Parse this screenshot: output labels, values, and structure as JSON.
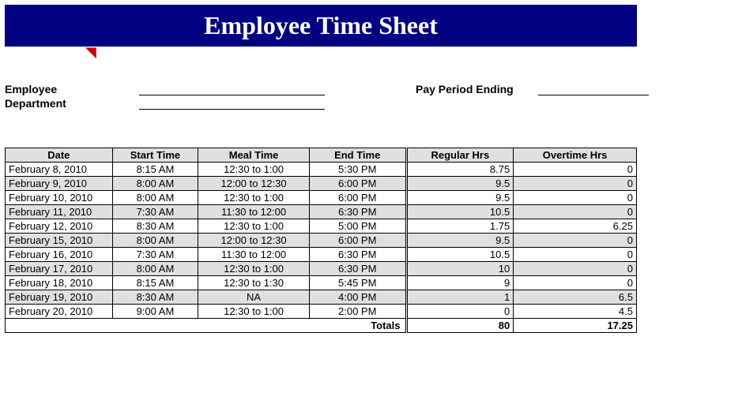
{
  "title": "Employee Time Sheet",
  "meta": {
    "employee_label": "Employee",
    "department_label": "Department",
    "pay_period_label": "Pay Period Ending"
  },
  "columns": {
    "date": "Date",
    "start": "Start Time",
    "meal": "Meal Time",
    "end": "End Time",
    "reg": "Regular Hrs",
    "ot": "Overtime Hrs"
  },
  "rows": [
    {
      "date": "February 8, 2010",
      "start": "8:15 AM",
      "meal": "12:30 to 1:00",
      "end": "5:30 PM",
      "reg": "8.75",
      "ot": "0"
    },
    {
      "date": "February 9, 2010",
      "start": "8:00 AM",
      "meal": "12:00 to 12:30",
      "end": "6:00 PM",
      "reg": "9.5",
      "ot": "0"
    },
    {
      "date": "February 10, 2010",
      "start": "8:00 AM",
      "meal": "12:30 to 1:00",
      "end": "6:00 PM",
      "reg": "9.5",
      "ot": "0"
    },
    {
      "date": "February 11, 2010",
      "start": "7:30 AM",
      "meal": "11:30 to 12:00",
      "end": "6:30 PM",
      "reg": "10.5",
      "ot": "0"
    },
    {
      "date": "February 12, 2010",
      "start": "8:30 AM",
      "meal": "12:30 to 1:00",
      "end": "5:00 PM",
      "reg": "1.75",
      "ot": "6.25"
    },
    {
      "date": "February 15, 2010",
      "start": "8:00 AM",
      "meal": "12:00 to 12:30",
      "end": "6:00 PM",
      "reg": "9.5",
      "ot": "0"
    },
    {
      "date": "February 16, 2010",
      "start": "7:30 AM",
      "meal": "11:30 to 12:00",
      "end": "6:30 PM",
      "reg": "10.5",
      "ot": "0"
    },
    {
      "date": "February 17, 2010",
      "start": "8:00 AM",
      "meal": "12:30 to 1:00",
      "end": "6:30 PM",
      "reg": "10",
      "ot": "0"
    },
    {
      "date": "February 18, 2010",
      "start": "8:15 AM",
      "meal": "12:30 to 1:30",
      "end": "5:45 PM",
      "reg": "9",
      "ot": "0"
    },
    {
      "date": "February 19, 2010",
      "start": "8:30 AM",
      "meal": "NA",
      "end": "4:00 PM",
      "reg": "1",
      "ot": "6.5"
    },
    {
      "date": "February 20, 2010",
      "start": "9:00 AM",
      "meal": "12:30 to 1:00",
      "end": "2:00 PM",
      "reg": "0",
      "ot": "4.5"
    }
  ],
  "totals": {
    "label": "Totals",
    "reg": "80",
    "ot": "17.25"
  }
}
